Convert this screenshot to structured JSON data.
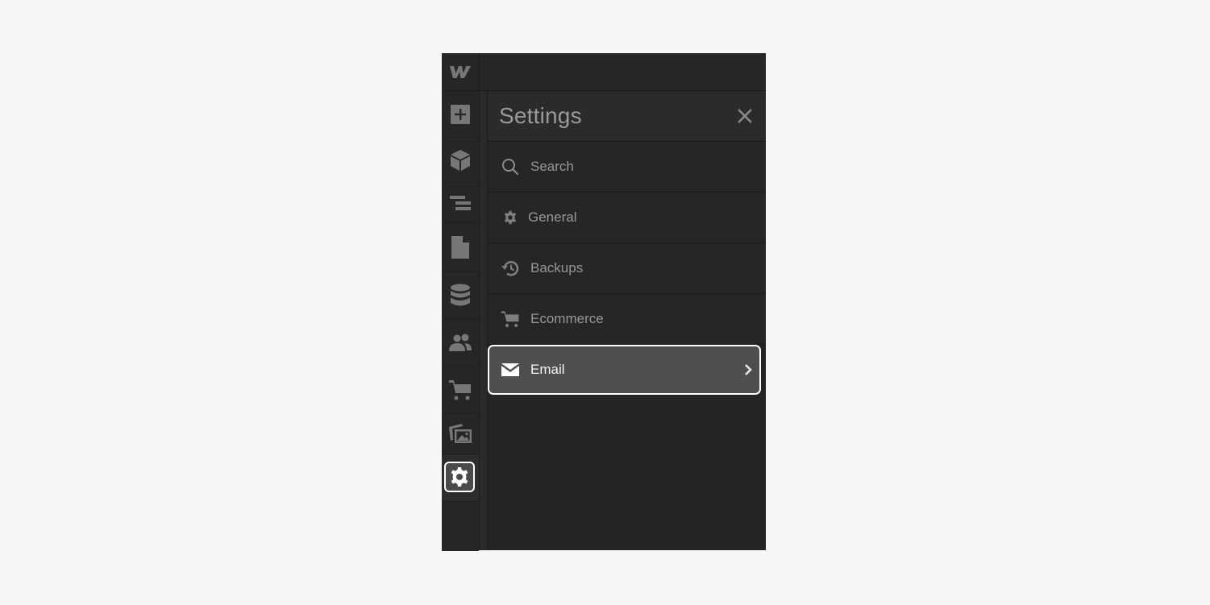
{
  "app": {
    "logo": "webflow-logo",
    "rail": [
      {
        "name": "add-panel",
        "icon": "plus-square-icon"
      },
      {
        "name": "components",
        "icon": "cube-icon"
      },
      {
        "name": "navigator",
        "icon": "layers-lines-icon"
      },
      {
        "name": "pages",
        "icon": "page-icon"
      },
      {
        "name": "cms",
        "icon": "database-icon"
      },
      {
        "name": "users",
        "icon": "users-icon"
      },
      {
        "name": "ecommerce",
        "icon": "cart-icon"
      },
      {
        "name": "assets",
        "icon": "images-icon"
      },
      {
        "name": "settings",
        "icon": "gear-icon",
        "active": true
      }
    ]
  },
  "settings_panel": {
    "title": "Settings",
    "close_icon": "close-icon",
    "search": {
      "placeholder": "Search",
      "icon": "search-icon"
    },
    "items": [
      {
        "label": "General",
        "icon": "gear-icon"
      },
      {
        "label": "Backups",
        "icon": "history-icon"
      },
      {
        "label": "Ecommerce",
        "icon": "cart-icon"
      },
      {
        "label": "Email",
        "icon": "envelope-icon",
        "active": true,
        "trailing_icon": "chevron-right-icon"
      }
    ]
  },
  "colors": {
    "background": "#f5f6f8",
    "panel": "#262626",
    "header": "#2b2b2b",
    "icon": "#7a7a7a",
    "text_muted": "#979797",
    "active_bg": "#4f4f4f",
    "active_border": "#ffffff"
  }
}
